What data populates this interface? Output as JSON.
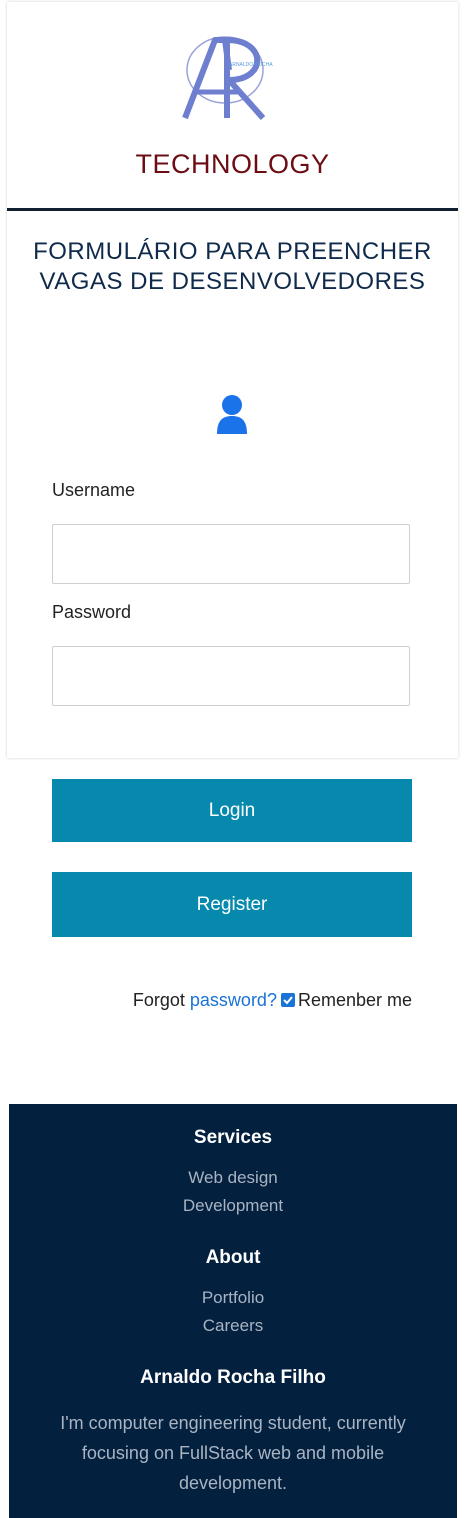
{
  "header": {
    "logo_text": "AR",
    "logo_subtext": "ARNALDO ROCHA",
    "brand": "TECHNOLOGY"
  },
  "form": {
    "title_line1": "FORMULÁRIO PARA PREENCHER",
    "title_line2": "VAGAS DE DESENVOLVEDORES",
    "user_icon": "user-icon",
    "username_label": "Username",
    "username_value": "",
    "password_label": "Password",
    "password_value": "",
    "login_label": "Login",
    "register_label": "Register",
    "forgot_prefix": "Forgot ",
    "forgot_link": "password?",
    "remember_checked": true,
    "remember_label": "Remenber me"
  },
  "footer": {
    "services_heading": "Services",
    "services_links": [
      "Web design",
      "Development"
    ],
    "about_heading": "About",
    "about_links": [
      "Portfolio",
      "Careers"
    ],
    "author_name": "Arnaldo Rocha Filho",
    "bio": "I'm computer engineering student, currently focusing on FullStack web and mobile development."
  },
  "colors": {
    "brand": "#6b0d13",
    "button": "#0689ad",
    "footer_bg": "#03203f",
    "link": "#1a73d6"
  }
}
